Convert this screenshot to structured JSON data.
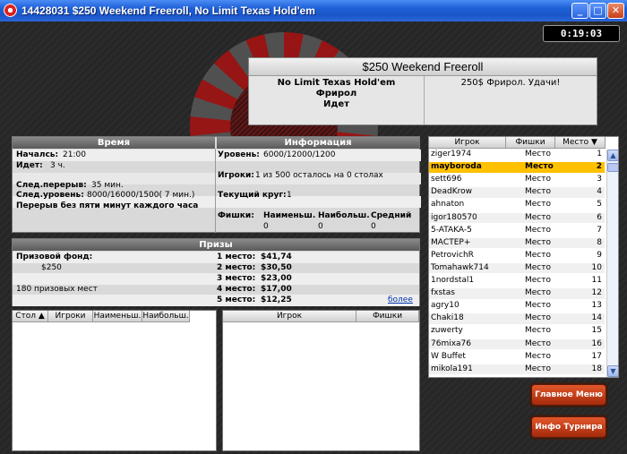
{
  "window": {
    "title": "14428031 $250 Weekend Freeroll, No Limit Texas Hold'em",
    "min": "_",
    "max": "□",
    "close": "✕"
  },
  "timer": "0:19:03",
  "header": {
    "title": "$250 Weekend Freeroll",
    "game": "No Limit Texas Hold'em",
    "type": "Фрирол",
    "status": "Идет",
    "description": "250$ Фрирол. Удачи!"
  },
  "time_section": {
    "heading": "Время",
    "started_label": "Началсь:",
    "started_value": "21:00",
    "running_label": "Идет:",
    "running_value": "3 ч.",
    "next_break_label": "След.перерыв:",
    "next_break_value": "35 мин.",
    "next_level_label": "След.уровень:",
    "next_level_value": "8000/16000/1500( 7 мин.)",
    "break_note": "Перерыв без пяти минут каждого часа"
  },
  "info_section": {
    "heading": "Информация",
    "level_label": "Уровень:",
    "level_value": "6000/12000/1200",
    "players_label": "Игроки:",
    "players_value": "1 из 500 осталось на 0 столах",
    "round_label": "Текущий круг:",
    "round_value": "1",
    "chips_label": "Фишки:",
    "chips_min_label": "Наименьш.",
    "chips_max_label": "Наибольш.",
    "chips_avg_label": "Средний",
    "chips_min": "0",
    "chips_max": "0",
    "chips_avg": "0"
  },
  "prizes": {
    "heading": "Призы",
    "fund_label": "Призовой фонд:",
    "fund_value": "$250",
    "places_note": "180 призовых мест",
    "more": "более",
    "items": [
      {
        "place": "1 место:",
        "amount": "$41,74"
      },
      {
        "place": "2 место:",
        "amount": "$30,50"
      },
      {
        "place": "3 место:",
        "amount": "$23,00"
      },
      {
        "place": "4 место:",
        "amount": "$17,00"
      },
      {
        "place": "5 место:",
        "amount": "$12,25"
      }
    ]
  },
  "tables_list": {
    "columns": [
      "Стол ▲",
      "Игроки",
      "Наименьш.",
      "Наибольш."
    ]
  },
  "table_players": {
    "columns": [
      "Игрок",
      "Фишки"
    ]
  },
  "players": {
    "columns": [
      "Игрок",
      "Фишки",
      "Место ▼"
    ],
    "rows": [
      {
        "name": "ziger1974",
        "chips": "Место",
        "place": "1"
      },
      {
        "name": "mayboroda",
        "chips": "Место",
        "place": "2"
      },
      {
        "name": "sett696",
        "chips": "Место",
        "place": "3"
      },
      {
        "name": "DeadKrow",
        "chips": "Место",
        "place": "4"
      },
      {
        "name": "ahnaton",
        "chips": "Место",
        "place": "5"
      },
      {
        "name": "igor180570",
        "chips": "Место",
        "place": "6"
      },
      {
        "name": "5-ATAKA-5",
        "chips": "Место",
        "place": "7"
      },
      {
        "name": "МАСТЕР+",
        "chips": "Место",
        "place": "8"
      },
      {
        "name": "PetrovichR",
        "chips": "Место",
        "place": "9"
      },
      {
        "name": "Tomahawk714",
        "chips": "Место",
        "place": "10"
      },
      {
        "name": "1nordstal1",
        "chips": "Место",
        "place": "11"
      },
      {
        "name": "fxstas",
        "chips": "Место",
        "place": "12"
      },
      {
        "name": "agry10",
        "chips": "Место",
        "place": "13"
      },
      {
        "name": "Chaki18",
        "chips": "Место",
        "place": "14"
      },
      {
        "name": "zuwerty",
        "chips": "Место",
        "place": "15"
      },
      {
        "name": "76mixa76",
        "chips": "Место",
        "place": "16"
      },
      {
        "name": "W Buffet",
        "chips": "Место",
        "place": "17"
      },
      {
        "name": "mikola191",
        "chips": "Место",
        "place": "18"
      }
    ],
    "scroll_up": "▲",
    "scroll_down": "▼"
  },
  "buttons": {
    "main_menu": "Главное Меню",
    "tournament_info": "Инфо Турнира"
  },
  "colors": {
    "highlight": "#ffc000",
    "titlebar": "#1d5fd6",
    "button": "#c03a14"
  }
}
